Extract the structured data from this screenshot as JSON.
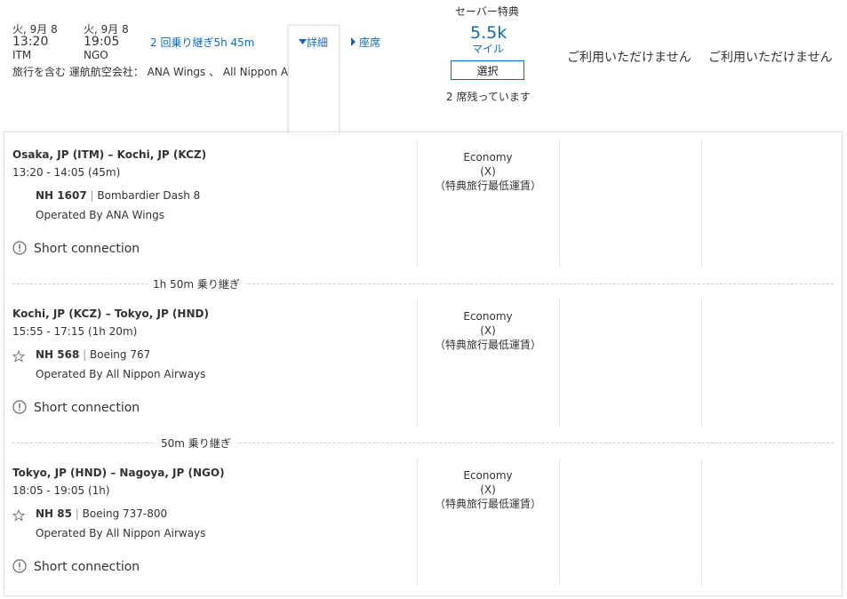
{
  "summary": {
    "depart_date": "火, 9月 8",
    "depart_time": "13:20",
    "depart_airport": "ITM",
    "arrive_date": "火, 9月 8",
    "arrive_time": "19:05",
    "arrive_airport": "NGO",
    "stops": "2 回乗り継ぎ",
    "duration": "5h 45m",
    "details_label": "詳細",
    "seats_label": "座席",
    "operated_by": "旅行を含む 運航航空会社： ANA Wings 、 All Nippon Airv"
  },
  "fare": {
    "header": "セーバー特典",
    "miles": "5.5k",
    "miles_unit": "マイル",
    "select_label": "選択",
    "seats_left": "2 席残っています",
    "unavailable_1": "ご利用いただけません",
    "unavailable_2": "ご利用いただけません"
  },
  "segments": [
    {
      "route": "Osaka, JP (ITM) – Kochi, JP (KCZ)",
      "times": "13:20 - 14:05 (45m)",
      "flight_no": "NH 1607",
      "separator": "|",
      "aircraft": "Bombardier Dash 8",
      "operator": "Operated By ANA Wings",
      "warning": "Short connection",
      "cabin": "Economy",
      "cabin_code": "(X)",
      "fare_type": "（特典旅行最低運賃）"
    },
    {
      "route": "Kochi, JP (KCZ) – Tokyo, JP (HND)",
      "times": "15:55 - 17:15 (1h 20m)",
      "flight_no": "NH 568",
      "separator": "|",
      "aircraft": "Boeing 767",
      "operator": "Operated By All Nippon Airways",
      "warning": "Short connection",
      "cabin": "Economy",
      "cabin_code": "(X)",
      "fare_type": "（特典旅行最低運賃）"
    },
    {
      "route": "Tokyo, JP (HND) – Nagoya, JP (NGO)",
      "times": "18:05 - 19:05 (1h)",
      "flight_no": "NH 85",
      "separator": "|",
      "aircraft": "Boeing 737-800",
      "operator": "Operated By All Nippon Airways",
      "warning": "Short connection",
      "cabin": "Economy",
      "cabin_code": "(X)",
      "fare_type": "（特典旅行最低運賃）"
    }
  ],
  "connections": [
    "1h 50m 乗り継ぎ",
    "50m 乗り継ぎ"
  ],
  "icons": {
    "warning": "exclamation-circle-icon",
    "partner": "star-alliance-icon",
    "caret_down": "caret-down-icon",
    "caret_right": "caret-right-icon"
  },
  "colors": {
    "link": "#0c6bbf",
    "text": "#333333",
    "border": "#e2e2e2"
  }
}
